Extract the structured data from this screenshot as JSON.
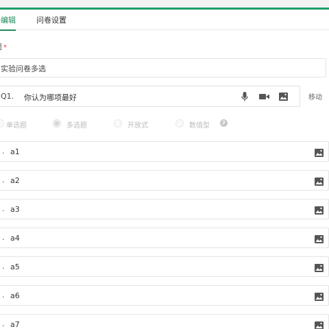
{
  "tabs": [
    {
      "label": "卷编辑",
      "active": true
    },
    {
      "label": "问卷设置",
      "active": false
    }
  ],
  "title_field": {
    "label": "题",
    "required_mark": "*",
    "value": "实验问卷多选"
  },
  "question": {
    "number": "Q1.",
    "text": "你认为哪项最好",
    "icons": [
      "mic-icon",
      "video-icon",
      "image-icon"
    ],
    "move_label": "移动"
  },
  "question_types": [
    {
      "label": "单选题",
      "selected": false
    },
    {
      "label": "多选题",
      "selected": true
    },
    {
      "label": "开放式",
      "selected": false
    },
    {
      "label": "数值型",
      "selected": false
    }
  ],
  "help_icon": "?",
  "options": [
    {
      "marker": ".",
      "text": "a1"
    },
    {
      "marker": ".",
      "text": "a2"
    },
    {
      "marker": ".",
      "text": "a3"
    },
    {
      "marker": ".",
      "text": "a4"
    },
    {
      "marker": ".",
      "text": "a5"
    },
    {
      "marker": ".",
      "text": "a6"
    },
    {
      "marker": ".",
      "text": "a7"
    }
  ],
  "colors": {
    "accent": "#1f8a5c",
    "top_border": "#1f9d6c",
    "required": "#e04848"
  }
}
